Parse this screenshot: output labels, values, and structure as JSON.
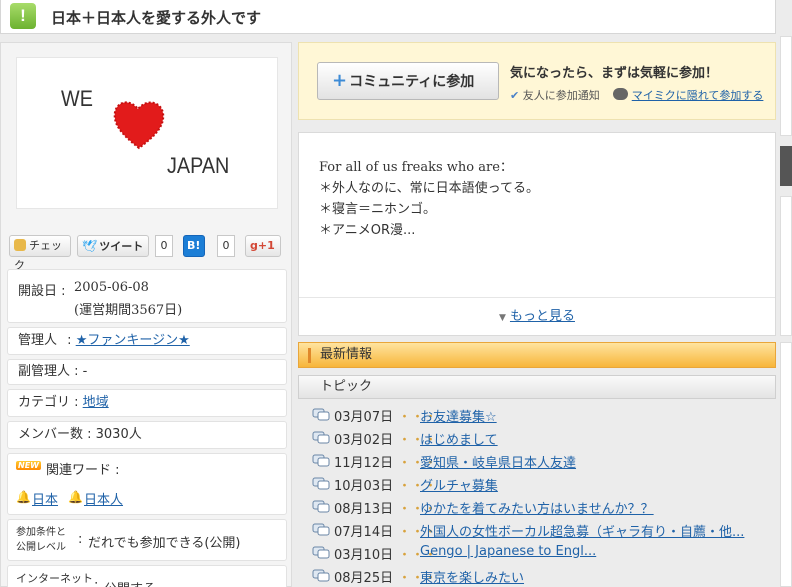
{
  "header": {
    "title": "日本＋日本人を愛する外人です",
    "icon_glyph": "!"
  },
  "logo": {
    "top_text": "WE",
    "bottom_text": "JAPAN"
  },
  "social": {
    "check_label": "チェック",
    "tweet_label": "ツイート",
    "tweet_count": "0",
    "hatena_label": "B!",
    "hatena_count": "0",
    "gplus_label": "g+1"
  },
  "info": {
    "opened_label": "開設日",
    "opened_value": "2005-06-08",
    "opened_period": "(運営期間3567日)",
    "admin_label": "管理人",
    "admin_value": "★ファンキージン★",
    "subadmin_label": "副管理人 : -",
    "category_label": "カテゴリ : ",
    "category_value": "地域",
    "members": "メンバー数 : 3030人",
    "new_badge": "NEW",
    "keywords_label": "関連ワード :",
    "keywords": [
      "日本",
      "日本人"
    ],
    "join_cond_label_1": "参加条件と",
    "join_cond_label_2": "公開レベル",
    "join_cond_value": "だれでも参加できる(公開)",
    "internet_label": "インターネット",
    "internet_value": "公開する"
  },
  "join": {
    "button_label": "コミュニティに参加",
    "message": "気になったら、まずは気軽に参加！",
    "notify_label": "友人に参加通知",
    "hidden_label": "マイミクに隠れて参加する"
  },
  "description": {
    "line1": "For all of us freaks who are：",
    "line2": "＊外人なのに、常に日本語使ってる。",
    "line3": "＊寝言＝ニホンゴ。",
    "line4": "＊アニメOR漫...",
    "more_label": "もっと見る"
  },
  "news": {
    "title": "最新情報"
  },
  "topics": {
    "title": "トピック",
    "items": [
      {
        "date": "03月07日",
        "title": "お友達募集☆"
      },
      {
        "date": "03月02日",
        "title": "はじめまして"
      },
      {
        "date": "11月12日",
        "title": "愛知県・岐阜県日本人友達"
      },
      {
        "date": "10月03日",
        "title": "グルチャ募集"
      },
      {
        "date": "08月13日",
        "title": "ゆかたを着てみたい方はいませんか？？"
      },
      {
        "date": "07月14日",
        "title": "外国人の女性ボーカル超急募（ギャラ有り・自薦・他..."
      },
      {
        "date": "03月10日",
        "title": "Gengo | Japanese to Engl..."
      },
      {
        "date": "08月25日",
        "title": "東京を楽しみたい"
      }
    ],
    "dots": "・・・"
  },
  "colors": {
    "link": "#1f62a8",
    "accent_green": "#6cb230",
    "news_orange": "#f7b53a",
    "join_bg": "#fff7d6"
  }
}
